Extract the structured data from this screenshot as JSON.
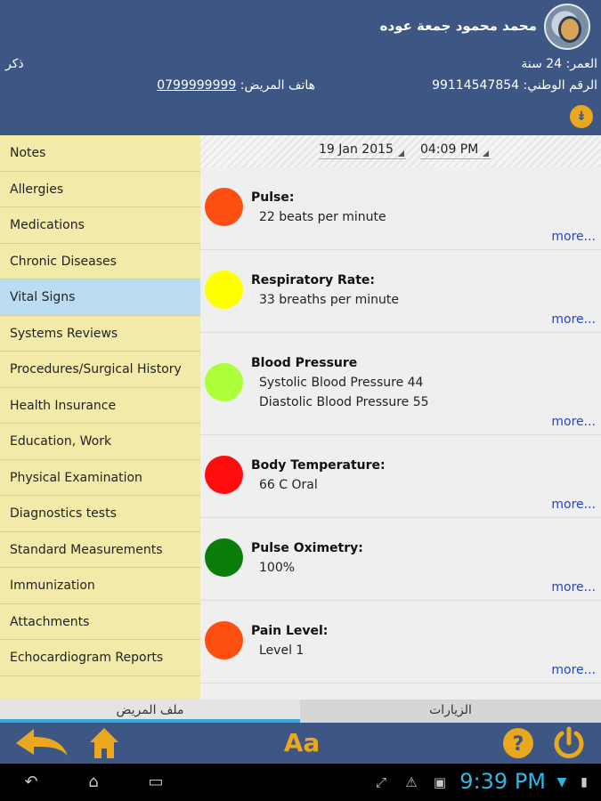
{
  "header": {
    "patient_name": "محمد محمود جمعة عوده",
    "age": "العمر: 24 سنة",
    "gender": "ذكر",
    "national_id": "الرقم الوطني: 99114547854",
    "phone_label": "هاتف المريض: ",
    "phone_number": "0799999999",
    "expand_icon": "double-chevron-down-icon"
  },
  "sidebar": {
    "items": [
      {
        "label": "Notes"
      },
      {
        "label": "Allergies"
      },
      {
        "label": "Medications"
      },
      {
        "label": "Chronic Diseases"
      },
      {
        "label": "Vital Signs"
      },
      {
        "label": "Systems Reviews"
      },
      {
        "label": "Procedures/Surgical History"
      },
      {
        "label": "Health Insurance"
      },
      {
        "label": "Education, Work"
      },
      {
        "label": "Physical Examination"
      },
      {
        "label": "Diagnostics tests"
      },
      {
        "label": "Standard Measurements"
      },
      {
        "label": "Immunization"
      },
      {
        "label": "Attachments"
      },
      {
        "label": "Echocardiogram Reports"
      }
    ],
    "active_index": 4
  },
  "datebar": {
    "date": "19 Jan 2015",
    "time": "04:09 PM"
  },
  "vitals": [
    {
      "title": "Pulse:",
      "lines": [
        "22 beats per minute"
      ],
      "more": "more...",
      "color": "#ff4e12"
    },
    {
      "title": "Respiratory Rate:",
      "lines": [
        "33 breaths per minute"
      ],
      "more": "more...",
      "color": "#ffff00"
    },
    {
      "title": "Blood Pressure",
      "lines": [
        "Systolic Blood Pressure 44",
        "Diastolic Blood Pressure 55"
      ],
      "more": "more...",
      "color": "#adff3a"
    },
    {
      "title": "Body Temperature:",
      "lines": [
        "66 C Oral"
      ],
      "more": "more...",
      "color": "#ff0d0d"
    },
    {
      "title": "Pulse Oximetry:",
      "lines": [
        "100%"
      ],
      "more": "more...",
      "color": "#0a7d0a"
    },
    {
      "title": "Pain Level:",
      "lines": [
        "Level 1"
      ],
      "more": "more...",
      "color": "#ff4e12"
    }
  ],
  "tabs": {
    "patient_file": "ملف المريض",
    "visits": "الزيارات"
  },
  "toolbar": {
    "font_label": "Aa",
    "icons": [
      "back-arrow-icon",
      "home-icon",
      "font-size-icon",
      "help-icon",
      "power-icon"
    ]
  },
  "system_bar": {
    "time": "9:39 PM"
  },
  "colors": {
    "header_bg": "#3d5684",
    "accent": "#e9a81e",
    "sidebar_bg": "#f1eaa9",
    "sidebar_active": "#bcdcf2",
    "link": "#1f45c8"
  }
}
